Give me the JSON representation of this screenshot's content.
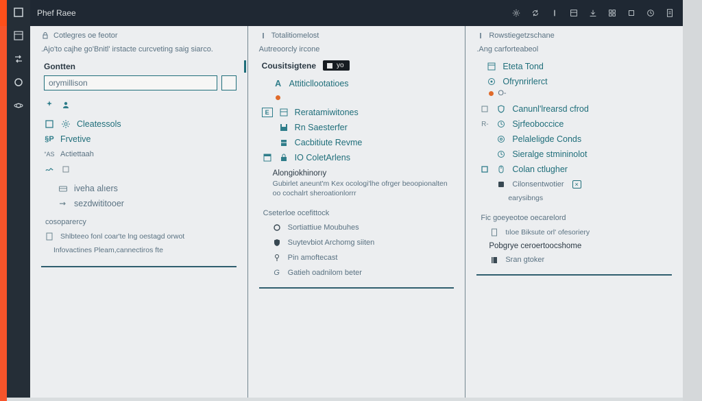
{
  "app": {
    "title": "Phef Raee"
  },
  "sidebar_icons": [
    "square",
    "panel",
    "arrows",
    "circle",
    "orbit"
  ],
  "topbar_icons": [
    "gear",
    "refresh",
    "pipe",
    "panel2",
    "down",
    "grid",
    "square2",
    "clock",
    "doc"
  ],
  "col1": {
    "header": "Cotlegres oe feotor",
    "subtitle": ".Ajo'to cajhe go'Bnitl' irstacte curcveting saig siarco.",
    "section": "Gontten",
    "input_value": "orymillison",
    "items1": [
      {
        "icon": "user",
        "label": ""
      },
      {
        "icon": "gear",
        "label": "Cleatessols",
        "pre": "square"
      },
      {
        "icon": "sp",
        "label": "Frvetive"
      },
      {
        "icon": "as",
        "label": "Actiettaah"
      },
      {
        "icon": "sqp",
        "label": ""
      }
    ],
    "items2": [
      {
        "icon": "card",
        "label": "iveha alıers"
      },
      {
        "icon": "arrow",
        "label": "sezdwititooer"
      }
    ],
    "group": "cosoparercy",
    "group_items": [
      "Shlbteeo fonl coar'te lng oestagd orwot",
      "Infovactines Pleam,cannectiros fte"
    ]
  },
  "col2": {
    "header": "Totalitiomelost",
    "subtitle": "Autreoorcly ircone",
    "section": "Cousitsigtene",
    "chip": "yo",
    "items1": [
      {
        "icon": "A",
        "label": "Attiticllootatioes"
      },
      {
        "icon": "dot",
        "label": ""
      },
      {
        "icon": "panel",
        "label": "Reratamiwitones",
        "pre": "E"
      },
      {
        "icon": "save",
        "label": "Rn Saesterfer"
      },
      {
        "icon": "cab",
        "label": "Cacbitiute Revme"
      },
      {
        "icon": "lock",
        "label": "IO ColetArlens"
      }
    ],
    "para_title": "Alongiokhinorıy",
    "para": "Gubirlet aneunt'm Kex ocologi'lhe ofrger beoopionalten oo cochalrt sheroationlorrr",
    "group": "Cseterloe ocefittock",
    "group_items": [
      {
        "icon": "circle",
        "label": "Sortiattiue Moubuhes"
      },
      {
        "icon": "shield",
        "label": "Suytevbiot Archomg siiten"
      },
      {
        "icon": "pin",
        "label": "Pin amoftecast"
      },
      {
        "icon": "G",
        "label": "Gatieh oadnilom beter"
      }
    ]
  },
  "col3": {
    "header": "Rowstiegetzschane",
    "subtitle": ".Ang carforteabeol",
    "items1": [
      {
        "icon": "panel",
        "label": "Eteta Tond"
      },
      {
        "icon": "target",
        "label": "Ofrynrirlerct"
      },
      {
        "icon": "dot",
        "label": "O-"
      }
    ],
    "items2": [
      {
        "icon": "shield",
        "label": "Canunl'lrearsd cfrod",
        "pre": "sq"
      },
      {
        "icon": "clock",
        "label": "Sjrfeoboccice",
        "pre": "R"
      },
      {
        "icon": "setting",
        "label": "Pelaleligde Conds"
      },
      {
        "icon": "clock",
        "label": "Sieralge stmininolot"
      },
      {
        "icon": "mouse",
        "label": "Colan ctlugher",
        "pre": "sq-teal"
      }
    ],
    "nested": {
      "icon": "device",
      "label": "Cilonsentwotier",
      "badge": "×",
      "sub": "earysibngs"
    },
    "group": "Fic goeyeotoe oecarelord",
    "group_items": [
      {
        "icon": "doc",
        "label": "tıloe Biksute orl' ofesoriery"
      },
      {
        "label2": "Pobgrye ceroertoocshome"
      },
      {
        "icon": "book",
        "label": "Sran gtoker"
      }
    ]
  }
}
